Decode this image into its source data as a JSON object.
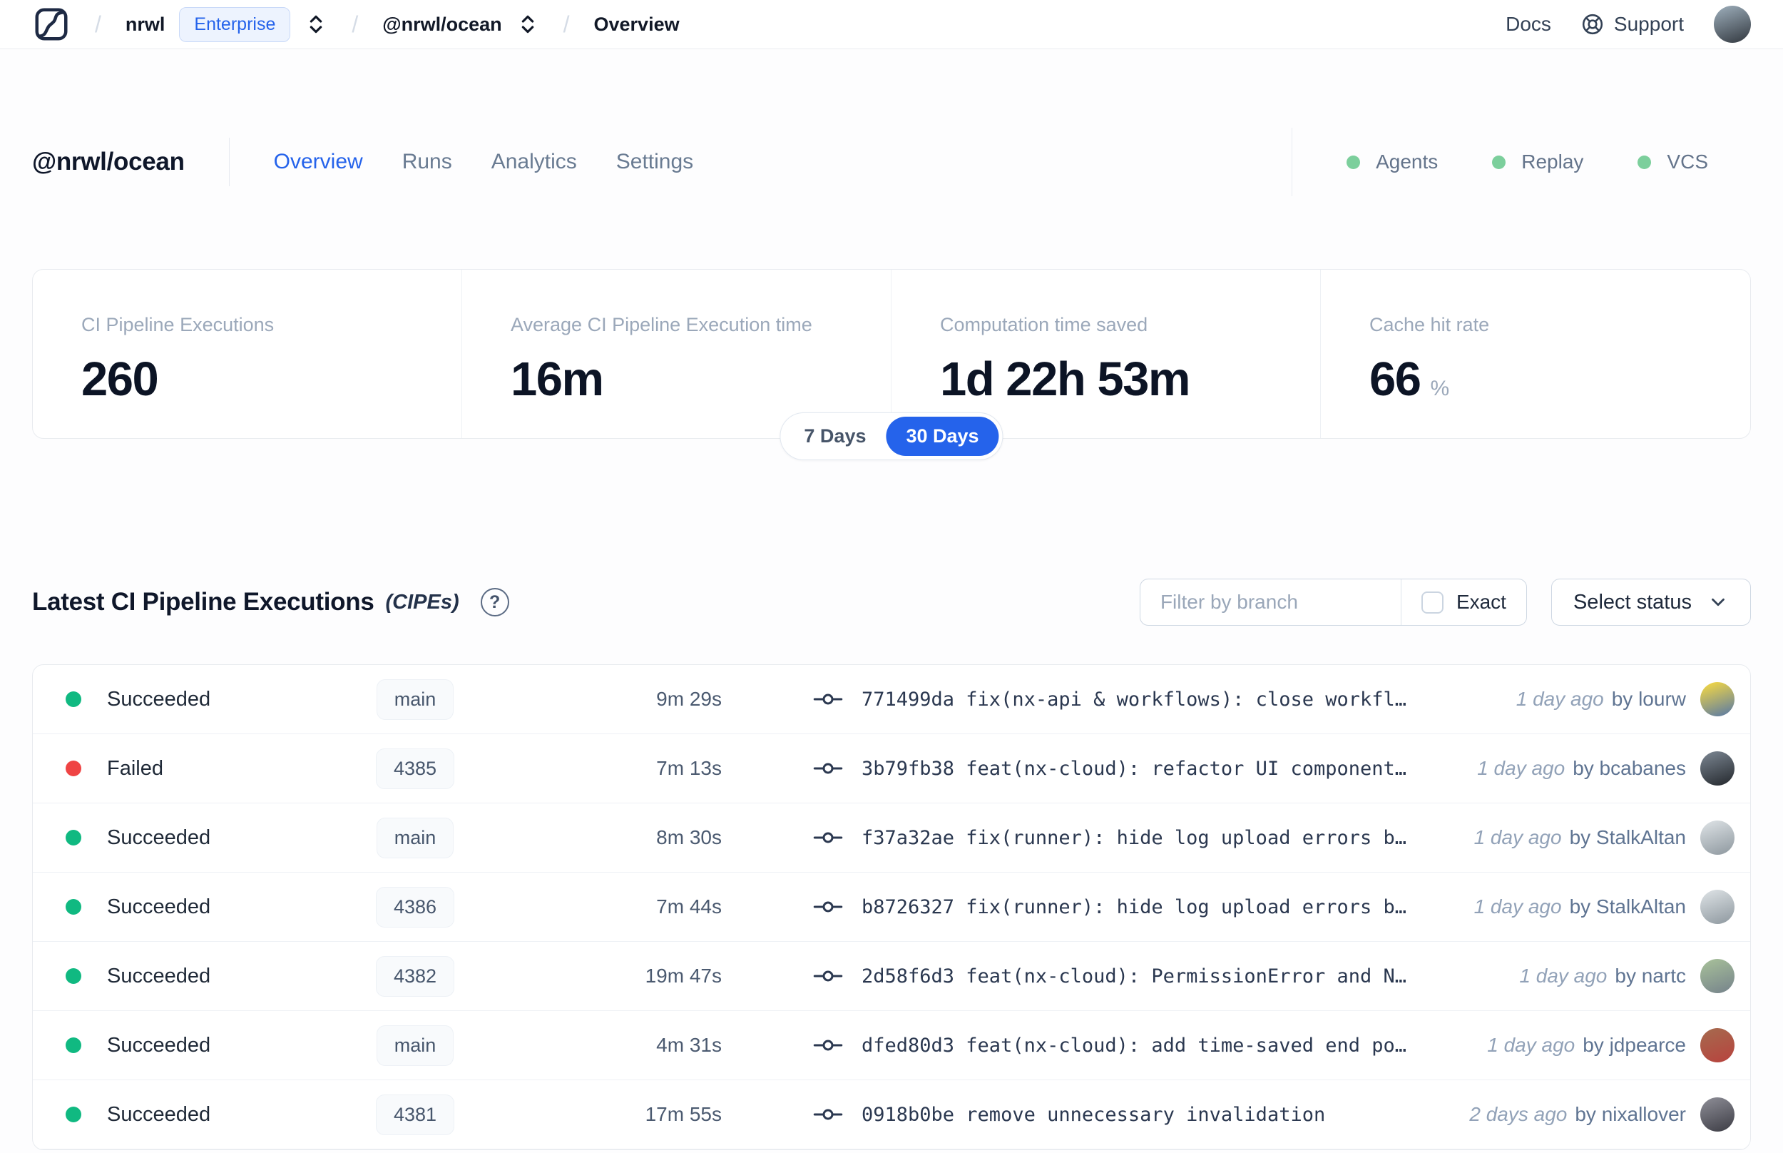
{
  "colors": {
    "accent_blue": "#2563eb",
    "success_green": "#10b981",
    "failed_red": "#ef4444",
    "feature_dot_green": "#7ccf9c"
  },
  "navbar": {
    "slash": "/",
    "org": "nrwl",
    "plan_badge": "Enterprise",
    "workspace": "@nrwl/ocean",
    "page": "Overview",
    "docs_label": "Docs",
    "support_label": "Support",
    "avatar_colors": [
      "#9fb0bd",
      "#32383f"
    ]
  },
  "header": {
    "title": "@nrwl/ocean",
    "tabs": [
      {
        "label": "Overview",
        "active": true
      },
      {
        "label": "Runs",
        "active": false
      },
      {
        "label": "Analytics",
        "active": false
      },
      {
        "label": "Settings",
        "active": false
      }
    ],
    "features": [
      {
        "label": "Agents"
      },
      {
        "label": "Replay"
      },
      {
        "label": "VCS"
      }
    ]
  },
  "stats": {
    "cards": [
      {
        "label": "CI Pipeline Executions",
        "value": "260",
        "suffix": ""
      },
      {
        "label": "Average CI Pipeline Execution time",
        "value": "16m",
        "suffix": ""
      },
      {
        "label": "Computation time saved",
        "value": "1d 22h 53m",
        "suffix": ""
      },
      {
        "label": "Cache hit rate",
        "value": "66",
        "suffix": "%"
      }
    ],
    "range": {
      "options": [
        "7 Days",
        "30 Days"
      ],
      "selected": "30 Days"
    }
  },
  "executions": {
    "title": "Latest CI Pipeline Executions",
    "suffix": "(CIPEs)",
    "help_glyph": "?",
    "filter_placeholder": "Filter by branch",
    "exact_label": "Exact",
    "status_select_label": "Select status",
    "rows": [
      {
        "status": "Succeeded",
        "state": "success",
        "branch": "main",
        "duration": "9m 29s",
        "commit": "771499da fix(nx-api & workflows): close workfl…",
        "time": "1 day ago",
        "author": "by lourw",
        "avatar_colors": [
          "#fddd3e",
          "#5577a8"
        ]
      },
      {
        "status": "Failed",
        "state": "failed",
        "branch": "4385",
        "duration": "7m 13s",
        "commit": "3b79fb38 feat(nx-cloud): refactor UI component…",
        "time": "1 day ago",
        "author": "by bcabanes",
        "avatar_colors": [
          "#7d8894",
          "#23272c"
        ]
      },
      {
        "status": "Succeeded",
        "state": "success",
        "branch": "main",
        "duration": "8m 30s",
        "commit": "f37a32ae fix(runner): hide log upload errors b…",
        "time": "1 day ago",
        "author": "by StalkAltan",
        "avatar_colors": [
          "#dfe4e7",
          "#8d979e"
        ]
      },
      {
        "status": "Succeeded",
        "state": "success",
        "branch": "4386",
        "duration": "7m 44s",
        "commit": "b8726327 fix(runner): hide log upload errors b…",
        "time": "1 day ago",
        "author": "by StalkAltan",
        "avatar_colors": [
          "#dfe4e7",
          "#8d979e"
        ]
      },
      {
        "status": "Succeeded",
        "state": "success",
        "branch": "4382",
        "duration": "19m 47s",
        "commit": "2d58f6d3 feat(nx-cloud): PermissionError and N…",
        "time": "1 day ago",
        "author": "by nartc",
        "avatar_colors": [
          "#a9c29a",
          "#75828b"
        ]
      },
      {
        "status": "Succeeded",
        "state": "success",
        "branch": "main",
        "duration": "4m 31s",
        "commit": "dfed80d3 feat(nx-cloud): add time-saved end po…",
        "time": "1 day ago",
        "author": "by jdpearce",
        "avatar_colors": [
          "#a56b4f",
          "#b8423d"
        ]
      },
      {
        "status": "Succeeded",
        "state": "success",
        "branch": "4381",
        "duration": "17m 55s",
        "commit": "0918b0be remove unnecessary invalidation",
        "time": "2 days ago",
        "author": "by nixallover",
        "avatar_colors": [
          "#8f8f98",
          "#3c3c44"
        ]
      }
    ]
  }
}
